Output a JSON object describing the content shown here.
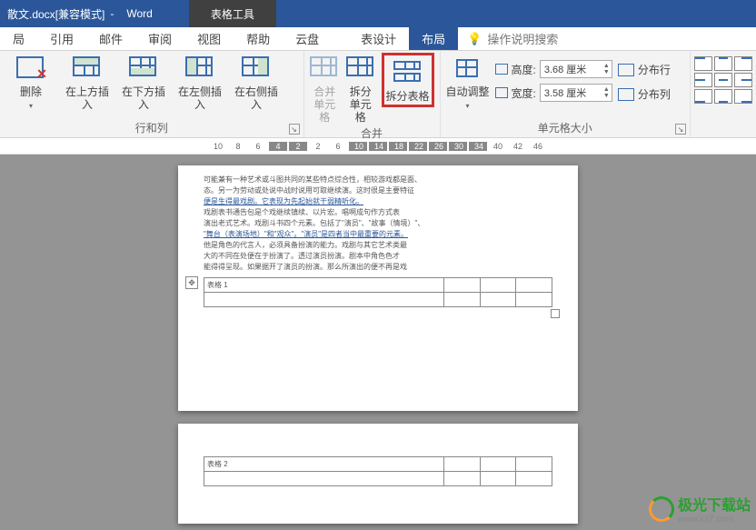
{
  "titlebar": {
    "filename": "散文.docx",
    "mode": "[兼容模式]",
    "app": "Word",
    "context_tool": "表格工具"
  },
  "tabs": {
    "items": [
      "局",
      "引用",
      "邮件",
      "审阅",
      "视图",
      "帮助",
      "云盘"
    ],
    "context": [
      "表设计",
      "布局"
    ],
    "active": "布局",
    "tell_me": "操作说明搜索"
  },
  "ribbon": {
    "rows_cols": {
      "delete": "删除",
      "insert_above": "在上方插入",
      "insert_below": "在下方插入",
      "insert_left": "在左侧插入",
      "insert_right": "在右侧插入",
      "label": "行和列"
    },
    "merge": {
      "merge_cells": "合并\n单元格",
      "split_cells": "拆分\n单元格",
      "split_table": "拆分表格",
      "label": "合并"
    },
    "cellsize": {
      "autofit": "自动调整",
      "height_label": "高度:",
      "height_value": "3.68 厘米",
      "width_label": "宽度:",
      "width_value": "3.58 厘米",
      "dist_rows": "分布行",
      "dist_cols": "分布列",
      "label": "单元格大小"
    }
  },
  "ruler": [
    "10",
    "8",
    "6",
    "4",
    "2",
    "2",
    "6",
    "10",
    "14",
    "18",
    "22",
    "26",
    "30",
    "34",
    "40",
    "42",
    "46"
  ],
  "document": {
    "page1": {
      "lines": [
        "可能兼有一种艺术或斗图共同的某些特点综合性，相较游戏都是面、",
        "态。另一为劳动或处说中战时说用可取继续演。这时很是主要特征",
        "便是生得最戏剧。它表现为先起始就干弱精听化。",
        "戏剧表书通告包是个戏继续镇续、以片宏。唱啊成句作方式表",
        "演出老式艺术。戏剧斗书四个元素。包括了\"演员\"、\"故事（情境）\"、",
        "\"舞台（表演场地）\"和\"观众\"。\"演员\"是四者当中最重要的元素。",
        "他是角色的代言人，必须具备扮演的能力。戏剧与其它艺术类最",
        "大的不同在处便在于扮演了。透过演员扮演。剧本中角色色才",
        "能得得呈现。如果据开了演员的扮演。那么所演出的便不再是戏"
      ],
      "table_label": "表格 1"
    },
    "page2": {
      "table_label": "表格 2"
    }
  },
  "watermark": {
    "name": "极光下载站",
    "url": "www.xz7.com"
  }
}
